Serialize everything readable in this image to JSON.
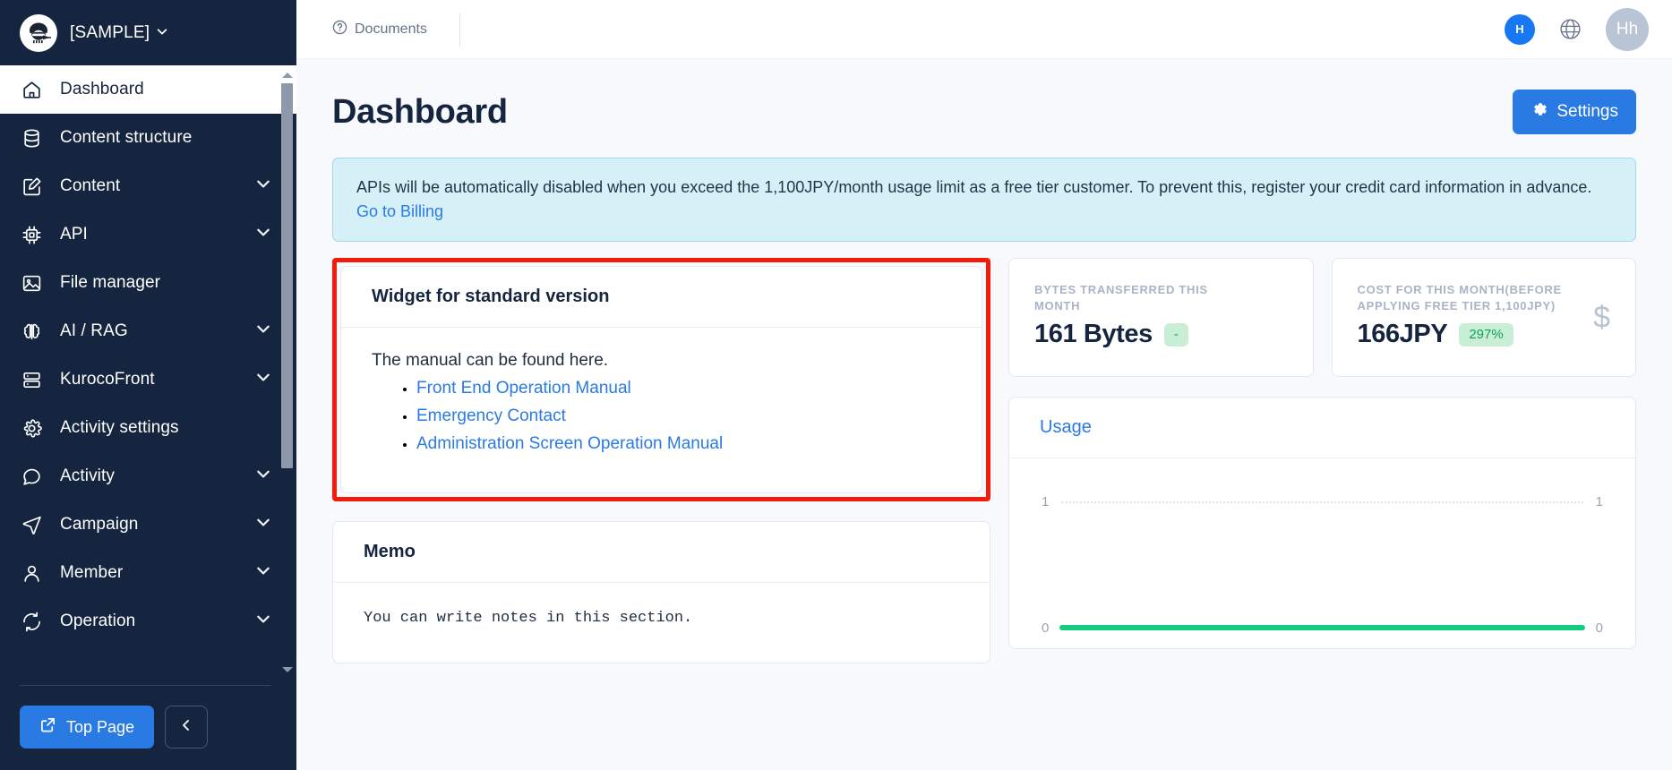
{
  "sidebar": {
    "brand": {
      "name": "[SAMPLE]",
      "logo_icon": "ninja-logo-icon",
      "chevron_icon": "chevron-down-icon"
    },
    "items": [
      {
        "label": "Dashboard",
        "icon": "home-icon",
        "active": true,
        "expandable": false
      },
      {
        "label": "Content structure",
        "icon": "database-icon",
        "active": false,
        "expandable": false
      },
      {
        "label": "Content",
        "icon": "edit-square-icon",
        "active": false,
        "expandable": true
      },
      {
        "label": "API",
        "icon": "chip-icon",
        "active": false,
        "expandable": true
      },
      {
        "label": "File manager",
        "icon": "image-icon",
        "active": false,
        "expandable": false
      },
      {
        "label": "AI / RAG",
        "icon": "brain-icon",
        "active": false,
        "expandable": true
      },
      {
        "label": "KurocoFront",
        "icon": "server-icon",
        "active": false,
        "expandable": true
      },
      {
        "label": "Activity settings",
        "icon": "gear-icon",
        "active": false,
        "expandable": false
      },
      {
        "label": "Activity",
        "icon": "chat-bubble-icon",
        "active": false,
        "expandable": true
      },
      {
        "label": "Campaign",
        "icon": "send-icon",
        "active": false,
        "expandable": true
      },
      {
        "label": "Member",
        "icon": "user-icon",
        "active": false,
        "expandable": true
      },
      {
        "label": "Operation",
        "icon": "refresh-icon",
        "active": false,
        "expandable": true
      }
    ],
    "footer": {
      "top_page_label": "Top Page",
      "top_page_icon": "external-link-icon",
      "collapse_icon": "chevron-left-icon"
    }
  },
  "topbar": {
    "documents_label": "Documents",
    "documents_icon": "question-circle-icon",
    "help_avatar": "H",
    "globe_icon": "globe-icon",
    "user_avatar": "Hh"
  },
  "page": {
    "title": "Dashboard",
    "settings_label": "Settings",
    "settings_icon": "gear-icon"
  },
  "alert": {
    "text": "APIs will be automatically disabled when you exceed the 1,100JPY/month usage limit as a free tier customer. To prevent this, register your credit card information in advance.",
    "link_label": "Go to Billing"
  },
  "widget_card": {
    "title": "Widget for standard version",
    "lead": "The manual can be found here.",
    "links": [
      "Front End Operation Manual",
      "Emergency Contact",
      "Administration Screen Operation Manual"
    ]
  },
  "memo_card": {
    "title": "Memo",
    "body": "You can write notes in this section."
  },
  "stats": [
    {
      "label": "BYTES TRANSFERRED THIS MONTH",
      "value": "161 Bytes",
      "badge": "-",
      "icon": ""
    },
    {
      "label": "COST FOR THIS MONTH(BEFORE APPLYING FREE TIER 1,100JPY)",
      "value": "166JPY",
      "badge": "297%",
      "icon": "$"
    }
  ],
  "usage_card": {
    "title": "Usage"
  },
  "chart_data": {
    "type": "line",
    "title": "Usage",
    "x": [
      0,
      1
    ],
    "series": [
      {
        "name": "Usage",
        "values": [
          0,
          0
        ],
        "color": "#12cd7d"
      }
    ],
    "left_axis_ticks": [
      "1",
      "0"
    ],
    "right_axis_ticks": [
      "1",
      "0"
    ],
    "ylim": [
      0,
      1
    ],
    "xlabel": "",
    "ylabel": "",
    "grid": true,
    "legend": "none"
  },
  "colors": {
    "sidebar_bg": "#152540",
    "accent_blue": "#2a7ae4",
    "highlight_red": "#f21b0c",
    "alert_bg": "#d6f0f8",
    "badge_green_bg": "#c8efd5",
    "badge_green_text": "#15a05a",
    "chart_line": "#12cd7d"
  }
}
